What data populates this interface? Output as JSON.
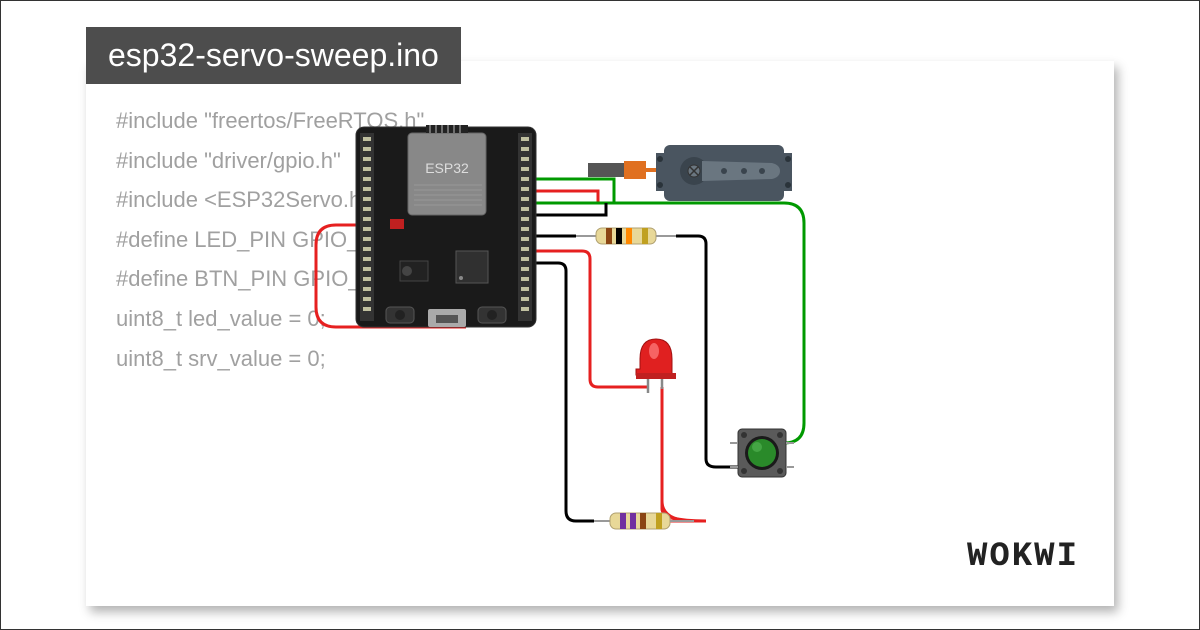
{
  "title": "esp32-servo-sweep.ino",
  "code_lines": [
    "#include \"freertos/FreeRTOS.h\"",
    "#include \"driver/gpio.h\"",
    "#include <ESP32Servo.h>",
    "",
    "",
    "#define LED_PIN GPIO_NUM_2",
    "#define BTN_PIN GPIO_NUM_4",
    "",
    "",
    "",
    "uint8_t led_value = 0;",
    "uint8_t srv_value = 0;"
  ],
  "board_label": "ESP32",
  "logo_text": "WOKWI",
  "components": {
    "board": "ESP32 DevKit",
    "servo": "Micro Servo",
    "led": "Red LED",
    "button": "Green Push Button",
    "resistor1": "Pull-up resistor",
    "resistor2": "Current limiting resistor"
  },
  "colors": {
    "title_bg": "#4d4d4d",
    "title_fg": "#ffffff",
    "code_fg": "#a0a0a0",
    "wire_red": "#e62020",
    "wire_green": "#009900",
    "wire_black": "#000000",
    "board_bg": "#202020",
    "button_green": "#2a8a2a"
  }
}
